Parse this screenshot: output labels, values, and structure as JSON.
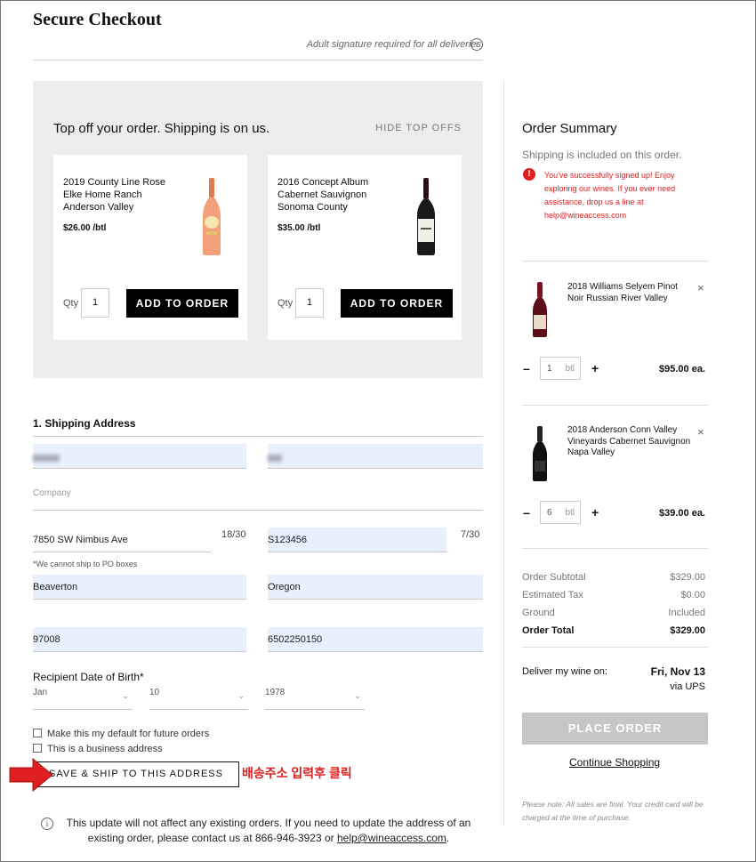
{
  "header": {
    "title": "Secure Checkout",
    "signature_note": "Adult signature required for all deliveries",
    "info_icon": "i"
  },
  "top_offs": {
    "title": "Top off your order. Shipping is on us.",
    "hide_label": "HIDE TOP OFFS",
    "items": [
      {
        "name": "2019 County Line Rose Elke Home Ranch Anderson Valley",
        "price": "$26.00 /btl",
        "qty_label": "Qty",
        "qty": "1",
        "button": "ADD TO ORDER",
        "bottle_icon": "rose-wine-bottle-icon",
        "bottle_color": "#f2a07a"
      },
      {
        "name": "2016 Concept Album Cabernet Sauvignon Sonoma County",
        "price": "$35.00 /btl",
        "qty_label": "Qty",
        "qty": "1",
        "button": "ADD TO ORDER",
        "bottle_icon": "red-wine-bottle-icon",
        "bottle_color": "#1a1a1a"
      }
    ]
  },
  "shipping": {
    "section_title": "1. Shipping Address",
    "company_placeholder": "Company",
    "address1": "7850 SW Nimbus Ave",
    "address1_counter": "18/30",
    "address2": "S123456",
    "address2_counter": "7/30",
    "po_note": "*We cannot ship to PO boxes",
    "city": "Beaverton",
    "state": "Oregon",
    "zip": "97008",
    "phone": "6502250150",
    "dob_label": "Recipient Date of Birth*",
    "dob_month": "Jan",
    "dob_day": "10",
    "dob_year": "1978",
    "default_checkbox_label": "Make this my default for future orders",
    "business_checkbox_label": "This is a business address",
    "save_button": "SAVE & SHIP TO THIS ADDRESS",
    "annotation": "배송주소 입력후 클릭",
    "update_note_text": "This update will not affect any existing orders. If you need to update the address of an existing order, please contact us at 866-946-3923 or ",
    "update_note_email": "help@wineaccess.com",
    "update_note_end": "."
  },
  "summary": {
    "title": "Order Summary",
    "shipping_note": "Shipping is included on this order.",
    "alert_icon": "!",
    "alert_text": "You've successfully signed up! Enjoy exploring our wines. If you ever need assistance, drop us a line at help@wineaccess.com",
    "items": [
      {
        "name": "2018 Williams Selyem Pinot Noir Russian River Valley",
        "qty": "1",
        "unit": "btl",
        "price": "$95.00 ea.",
        "remove": "×",
        "minus": "–",
        "plus": "+"
      },
      {
        "name": "2018 Anderson Conn Valley Vineyards Cabernet Sauvignon Napa Valley",
        "qty": "6",
        "unit": "btl",
        "price": "$39.00 ea.",
        "remove": "×",
        "minus": "–",
        "plus": "+"
      }
    ],
    "subtotal_label": "Order Subtotal",
    "subtotal": "$329.00",
    "tax_label": "Estimated Tax",
    "tax": "$0.00",
    "ground_label": "Ground",
    "ground": "Included",
    "total_label": "Order Total",
    "total": "$329.00",
    "deliver_label": "Deliver my wine on:",
    "deliver_date": "Fri, Nov 13",
    "deliver_via": "via UPS",
    "place_order": "PLACE ORDER",
    "continue": "Continue Shopping",
    "final_note": "Please note: All sales are final. Your credit card will be charged at the time of purchase."
  },
  "colors": {
    "accent_red": "#e02020",
    "autofill_blue": "#e8f0fe",
    "button_black": "#000000",
    "disabled_gray": "#c6c6c6"
  }
}
